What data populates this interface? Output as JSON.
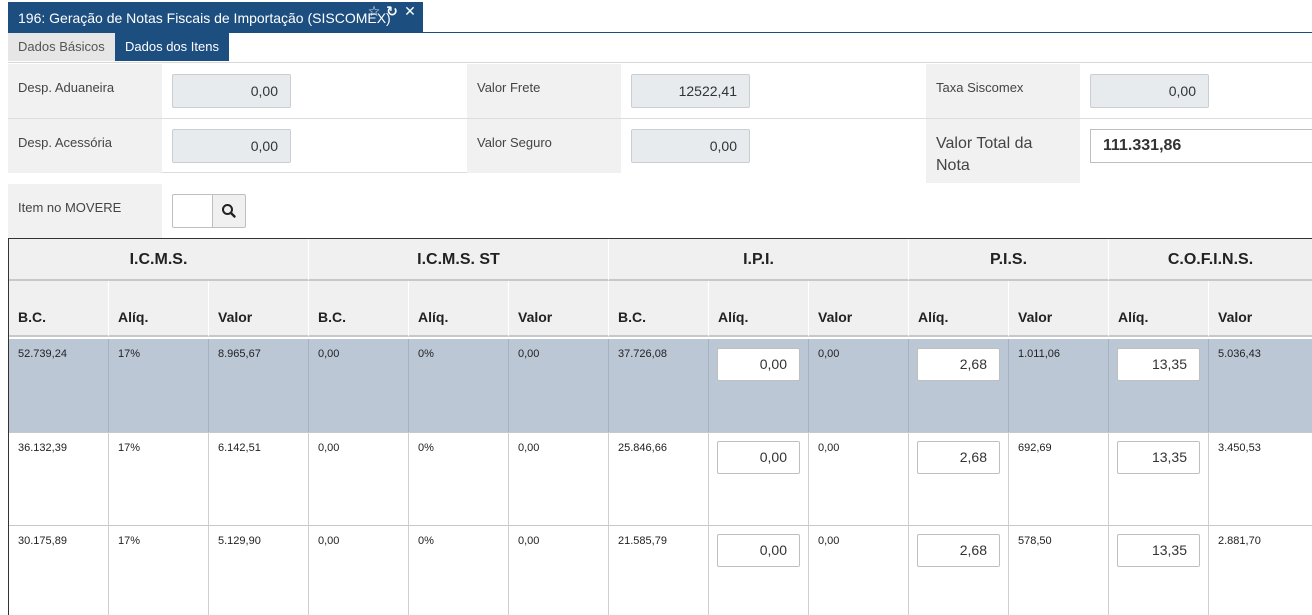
{
  "window": {
    "title": "196: Geração de Notas Fiscais de Importação (SISCOMEX)",
    "star_icon": "☆",
    "refresh_icon": "↻",
    "close_icon": "✕",
    "header_color": "#1d4e80"
  },
  "tabs": [
    {
      "label": "Dados Básicos",
      "active": false
    },
    {
      "label": "Dados dos Itens",
      "active": true
    }
  ],
  "form": {
    "desp_aduaneira": {
      "label": "Desp. Aduaneira",
      "value": "0,00"
    },
    "valor_frete": {
      "label": "Valor Frete",
      "value": "12522,41"
    },
    "taxa_siscomex": {
      "label": "Taxa Siscomex",
      "value": "0,00"
    },
    "desp_acessoria": {
      "label": "Desp. Acessória",
      "value": "0,00"
    },
    "valor_seguro": {
      "label": "Valor Seguro",
      "value": "0,00"
    },
    "valor_total_nota": {
      "label": "Valor Total da Nota",
      "value": "111.331,86"
    },
    "item_movere": {
      "label": "Item no MOVERE",
      "value": "",
      "search_icon": "search-icon"
    }
  },
  "grid": {
    "groups": [
      "I.C.M.S.",
      "I.C.M.S. ST",
      "I.P.I.",
      "P.I.S.",
      "C.O.F.I.N.S."
    ],
    "columns": [
      "B.C.",
      "Alíq.",
      "Valor",
      "B.C.",
      "Alíq.",
      "Valor",
      "B.C.",
      "Alíq.",
      "Valor",
      "Alíq.",
      "Valor",
      "Alíq.",
      "Valor"
    ],
    "selected_row_color": "#bcc7d6",
    "rows": [
      {
        "icms_bc": "52.739,24",
        "icms_aliq": "17%",
        "icms_valor": "8.965,67",
        "st_bc": "0,00",
        "st_aliq": "0%",
        "st_valor": "0,00",
        "ipi_bc": "37.726,08",
        "ipi_aliq": "0,00",
        "ipi_valor": "0,00",
        "pis_aliq": "2,68",
        "pis_valor": "1.011,06",
        "cofins_aliq": "13,35",
        "cofins_valor": "5.036,43"
      },
      {
        "icms_bc": "36.132,39",
        "icms_aliq": "17%",
        "icms_valor": "6.142,51",
        "st_bc": "0,00",
        "st_aliq": "0%",
        "st_valor": "0,00",
        "ipi_bc": "25.846,66",
        "ipi_aliq": "0,00",
        "ipi_valor": "0,00",
        "pis_aliq": "2,68",
        "pis_valor": "692,69",
        "cofins_aliq": "13,35",
        "cofins_valor": "3.450,53"
      },
      {
        "icms_bc": "30.175,89",
        "icms_aliq": "17%",
        "icms_valor": "5.129,90",
        "st_bc": "0,00",
        "st_aliq": "0%",
        "st_valor": "0,00",
        "ipi_bc": "21.585,79",
        "ipi_aliq": "0,00",
        "ipi_valor": "0,00",
        "pis_aliq": "2,68",
        "pis_valor": "578,50",
        "cofins_aliq": "13,35",
        "cofins_valor": "2.881,70"
      }
    ]
  }
}
